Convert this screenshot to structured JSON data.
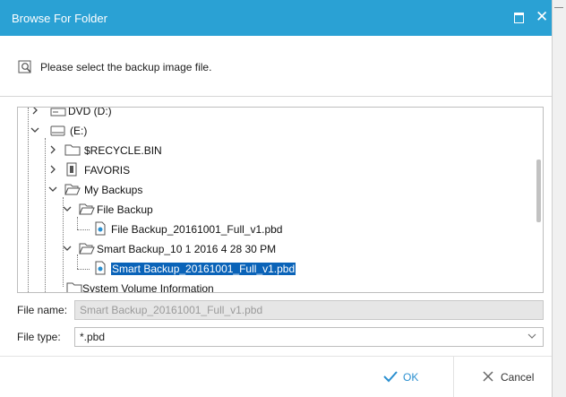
{
  "window": {
    "title": "Browse For Folder"
  },
  "instruction": {
    "text": "Please select the backup image file."
  },
  "tree": {
    "items": [
      {
        "label": "DVD (D:)",
        "expander": "collapsed",
        "icon": "dvd-drive-icon"
      },
      {
        "label": "(E:)",
        "expander": "expanded",
        "icon": "drive-icon"
      },
      {
        "label": "$RECYCLE.BIN",
        "expander": "collapsed",
        "icon": "folder-icon"
      },
      {
        "label": "FAVORIS",
        "expander": "collapsed",
        "icon": "special-folder-icon"
      },
      {
        "label": "My Backups",
        "expander": "expanded",
        "icon": "folder-open-icon"
      },
      {
        "label": "File Backup",
        "expander": "expanded",
        "icon": "folder-open-icon"
      },
      {
        "label": "File Backup_20161001_Full_v1.pbd",
        "expander": "none",
        "icon": "backup-file-icon"
      },
      {
        "label": "Smart Backup_10 1 2016 4 28 30 PM",
        "expander": "expanded",
        "icon": "folder-open-icon"
      },
      {
        "label": "Smart Backup_20161001_Full_v1.pbd",
        "expander": "none",
        "icon": "backup-file-icon",
        "selected": true
      },
      {
        "label": "System Volume Information",
        "expander": "none",
        "icon": "folder-icon"
      }
    ]
  },
  "file_name": {
    "label": "File name:",
    "value": "Smart Backup_20161001_Full_v1.pbd"
  },
  "file_type": {
    "label": "File type:",
    "value": "*.pbd"
  },
  "buttons": {
    "ok": "OK",
    "cancel": "Cancel"
  },
  "colors": {
    "titlebar": "#2aa1d4",
    "selection": "#0a63b8",
    "ok_check": "#2a8fd0"
  }
}
